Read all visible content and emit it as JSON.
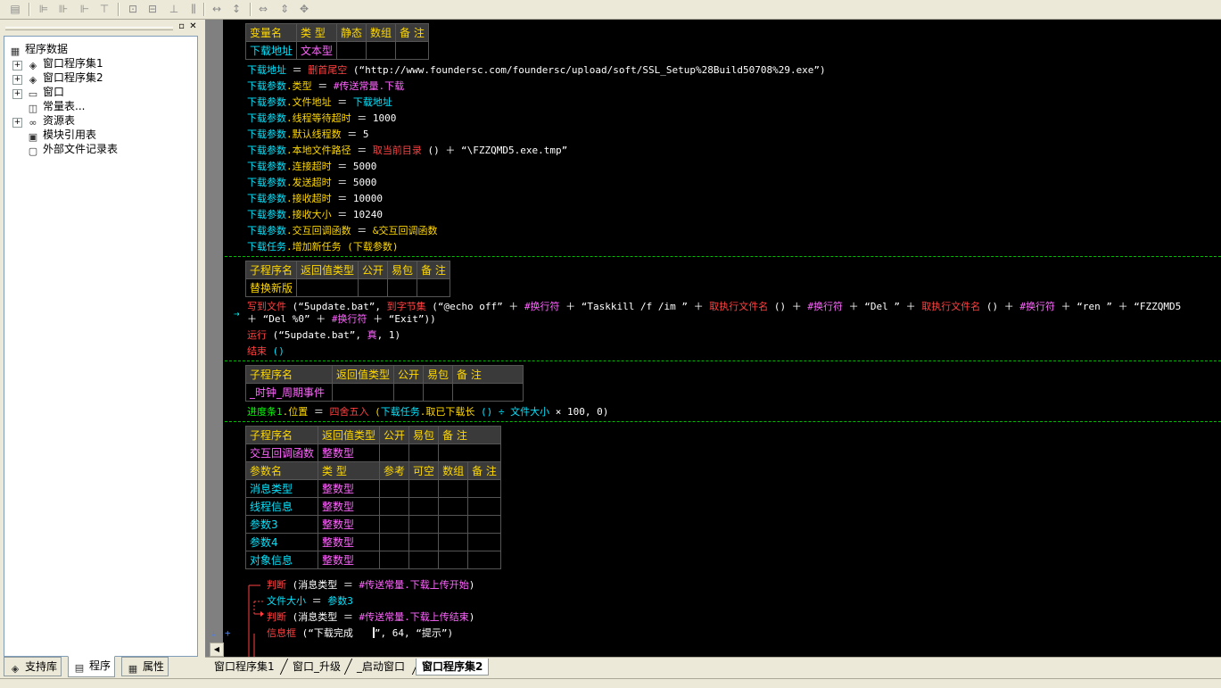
{
  "toolbar": {
    "icons": [
      "form-icon",
      "align-left-icon",
      "align-center-icon",
      "align-right-icon",
      "align-top-icon",
      "align-middle-icon",
      "align-bottom-icon",
      "same-width-icon",
      "same-height-icon",
      "equal-h-space-icon",
      "equal-v-space-icon",
      "center-h-icon",
      "center-v-icon",
      "center-both-icon"
    ]
  },
  "tree": {
    "root": "程序数据",
    "items": [
      {
        "label": "窗口程序集1",
        "icon": "module-icon",
        "expandable": true
      },
      {
        "label": "窗口程序集2",
        "icon": "module-icon",
        "expandable": true
      },
      {
        "label": "窗口",
        "icon": "window-icon",
        "expandable": true
      },
      {
        "label": "常量表...",
        "icon": "constant-icon",
        "expandable": false
      },
      {
        "label": "资源表",
        "icon": "resource-icon",
        "expandable": true
      },
      {
        "label": "模块引用表",
        "icon": "module-ref-icon",
        "expandable": false
      },
      {
        "label": "外部文件记录表",
        "icon": "file-record-icon",
        "expandable": false
      }
    ]
  },
  "left_tabs": [
    {
      "label": "支持库"
    },
    {
      "label": "程序"
    },
    {
      "label": "属性"
    }
  ],
  "doc_tabs": [
    {
      "label": "窗口程序集1"
    },
    {
      "label": "窗口_升级"
    },
    {
      "label": "_启动窗口"
    },
    {
      "label": "窗口程序集2"
    }
  ],
  "decl1": {
    "headers": [
      "变量名",
      "类 型",
      "静态",
      "数组",
      "备 注"
    ],
    "row": [
      "下载地址",
      "文本型",
      "",
      "",
      ""
    ]
  },
  "decl2": {
    "headers": [
      "子程序名",
      "返回值类型",
      "公开",
      "易包",
      "备 注"
    ],
    "row": [
      "替换新版",
      "",
      "",
      "",
      ""
    ]
  },
  "decl3": {
    "headers": [
      "子程序名",
      "返回值类型",
      "公开",
      "易包",
      "备 注"
    ],
    "row": [
      "_时钟_周期事件",
      "",
      "",
      "",
      ""
    ]
  },
  "decl4": {
    "headers": [
      "子程序名",
      "返回值类型",
      "公开",
      "易包",
      "备 注"
    ],
    "row": [
      "交互回调函数",
      "整数型",
      "",
      "",
      ""
    ],
    "param_headers": [
      "参数名",
      "类 型",
      "参考",
      "可空",
      "数组",
      "备 注"
    ],
    "params": [
      [
        "消息类型",
        "整数型"
      ],
      [
        "线程信息",
        "整数型"
      ],
      [
        "参数3",
        "整数型"
      ],
      [
        "参数4",
        "整数型"
      ],
      [
        "对象信息",
        "整数型"
      ]
    ]
  },
  "code": {
    "l1_a": "下载地址",
    "l1_b": " ＝ ",
    "l1_c": "删首尾空",
    "l1_d": " (“http://www.foundersc.com/foundersc/upload/soft/SSL_Setup%28Build50708%29.exe”)",
    "l2_a": "下载参数",
    "l2_b": ".类型",
    "l2_c": " ＝ ",
    "l2_d": "#传送常量.下载",
    "l3_a": "下载参数",
    "l3_b": ".文件地址",
    "l3_c": " ＝ ",
    "l3_d": "下载地址",
    "l4_a": "下载参数",
    "l4_b": ".线程等待超时",
    "l4_c": " ＝ 1000",
    "l5_a": "下载参数",
    "l5_b": ".默认线程数",
    "l5_c": " ＝ 5",
    "l6_a": "下载参数",
    "l6_b": ".本地文件路径",
    "l6_c": " ＝ ",
    "l6_d": "取当前目录",
    "l6_e": " () ＋ “\\FZZQMD5.exe.tmp”",
    "l7_a": "下载参数",
    "l7_b": ".连接超时",
    "l7_c": " ＝ 5000",
    "l8_a": "下载参数",
    "l8_b": ".发送超时",
    "l8_c": " ＝ 5000",
    "l9_a": "下载参数",
    "l9_b": ".接收超时",
    "l9_c": " ＝ 10000",
    "l10_a": "下载参数",
    "l10_b": ".接收大小",
    "l10_c": " ＝ 10240",
    "l11_a": "下载参数",
    "l11_b": ".交互回调函数",
    "l11_c": " ＝ ",
    "l11_d": "&交互回调函数",
    "l12_a": "下载任务",
    "l12_b": ".增加新任务",
    "l12_c": " (下载参数)",
    "w1_a": "写到文件",
    "w1_b": " (“5update.bat”, ",
    "w1_c": "到字节集",
    "w1_d": " (“@echo off” ＋ ",
    "w1_e": "#换行符",
    "w1_f": " ＋ “Taskkill /f /im ” ＋ ",
    "w1_g": "取执行文件名",
    "w1_h": " () ＋ ",
    "w1_i": "#换行符",
    "w1_j": " ＋ “Del ” ＋ ",
    "w1_k": "取执行文件名",
    "w1_l": " () ＋ ",
    "w1_m": "#换行符",
    "w1_n": " ＋ “ren ” ＋ “FZZQMD5",
    "w2_a": "＋ “Del %0” ＋ ",
    "w2_b": "#换行符",
    "w2_c": " ＋ “Exit”))",
    "r1_a": "运行",
    "r1_b": " (“5update.bat”, ",
    "r1_c": "真",
    "r1_d": ", 1)",
    "e1_a": "结束",
    "e1_b": " ()",
    "p1_a": "进度条1",
    "p1_b": ".位置",
    "p1_c": " ＝ ",
    "p1_d": "四舍五入",
    "p1_e": " (",
    "p1_f": "下载任务",
    "p1_g": ".取已下载长",
    "p1_h": " () ÷ ",
    "p1_i": "文件大小",
    "p1_j": " × 100, 0)",
    "j1_a": "判断",
    "j1_b": " (消息类型 ＝ ",
    "j1_c": "#传送常量.下载上传开始",
    "j1_d": ")",
    "f1_a": "文件大小",
    "f1_b": " ＝ ",
    "f1_c": "参数3",
    "j2_a": "判断",
    "j2_b": " (消息类型 ＝ ",
    "j2_c": "#传送常量.下载上传结束",
    "j2_d": ")",
    "m1_a": "信息框",
    "m1_b": " (“下载完成",
    "m1_c": "”, 64, “提示”)"
  }
}
